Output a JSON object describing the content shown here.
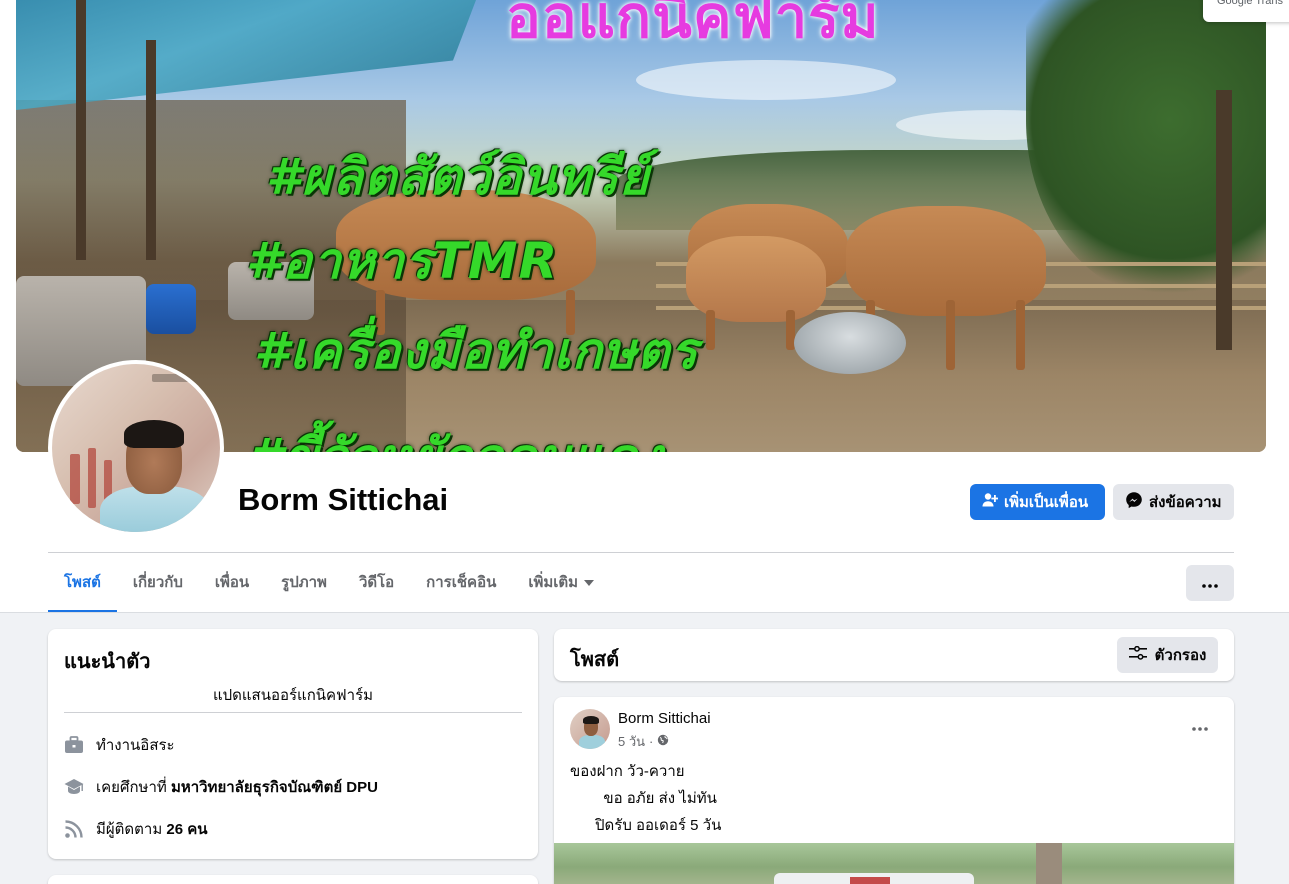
{
  "cover": {
    "title": "ออแกนิคฟาร์ม",
    "lines": [
      "#ผลิตสัตว์อินทรีย์",
      "#อาหารTMR",
      "#เครื่องมือทำเกษตร",
      "#ขี้วัวหยักอุดมแดง"
    ]
  },
  "translate_chip": "Google Trans",
  "profile": {
    "name": "Borm Sittichai"
  },
  "actions": {
    "add_friend": "เพิ่มเป็นเพื่อน",
    "message": "ส่งข้อความ"
  },
  "tabs": [
    {
      "label": "โพสต์",
      "active": true
    },
    {
      "label": "เกี่ยวกับ"
    },
    {
      "label": "เพื่อน"
    },
    {
      "label": "รูปภาพ"
    },
    {
      "label": "วิดีโอ"
    },
    {
      "label": "การเช็คอิน"
    },
    {
      "label": "เพิ่มเติม"
    }
  ],
  "intro": {
    "title": "แนะนำตัว",
    "bio": "แปดแสนออร์แกนิคฟาร์ม",
    "work": "ทำงานอิสระ",
    "education_prefix": "เคยศึกษาที่",
    "education_school": "มหาวิทยาลัยธุรกิจบัณฑิตย์ DPU",
    "followers_prefix": "มีผู้ติดตาม",
    "followers_count": "26 คน"
  },
  "posts": {
    "title": "โพสต์",
    "filter_label": "ตัวกรอง"
  },
  "post": {
    "author": "Borm Sittichai",
    "time": "5 วัน",
    "lines": [
      "ของฝาก วัว-ควาย",
      "        ขอ อภัย ส่ง ไม่ทัน",
      "      ปิดรับ ออเดอร์ 5 วัน"
    ]
  },
  "colors": {
    "accent": "#1b74e4",
    "page_bg": "#f0f2f5",
    "button_gray": "#e4e6eb"
  }
}
